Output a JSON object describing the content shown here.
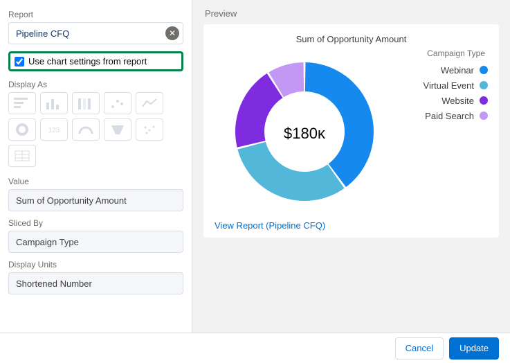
{
  "form": {
    "report_label": "Report",
    "report_value": "Pipeline CFQ",
    "use_settings_label": "Use chart settings from report",
    "use_settings_checked": true,
    "display_as_label": "Display As",
    "value_label": "Value",
    "value_value": "Sum of Opportunity Amount",
    "sliced_by_label": "Sliced By",
    "sliced_by_value": "Campaign Type",
    "display_units_label": "Display Units",
    "display_units_value": "Shortened Number"
  },
  "chart_types": [
    "horizontal-bar",
    "vertical-bar",
    "stacked-bar",
    "scatter",
    "line",
    "donut",
    "metric",
    "gauge",
    "funnel",
    "grouped-scatter",
    "table"
  ],
  "preview": {
    "section_title": "Preview",
    "chart_title": "Sum of Opportunity Amount",
    "center_value": "$180ᴋ",
    "legend_title": "Campaign Type",
    "link_text": "View Report (Pipeline CFQ)"
  },
  "chart_data": {
    "type": "pie",
    "title": "Sum of Opportunity Amount",
    "center_label": "$180K",
    "series": [
      {
        "name": "Webinar",
        "value": 72,
        "color": "#1589ee"
      },
      {
        "name": "Virtual Event",
        "value": 56,
        "color": "#52b7d8"
      },
      {
        "name": "Website",
        "value": 36,
        "color": "#7f2ce1"
      },
      {
        "name": "Paid Search",
        "value": 16,
        "color": "#c398f5"
      }
    ]
  },
  "footer": {
    "cancel": "Cancel",
    "update": "Update"
  }
}
